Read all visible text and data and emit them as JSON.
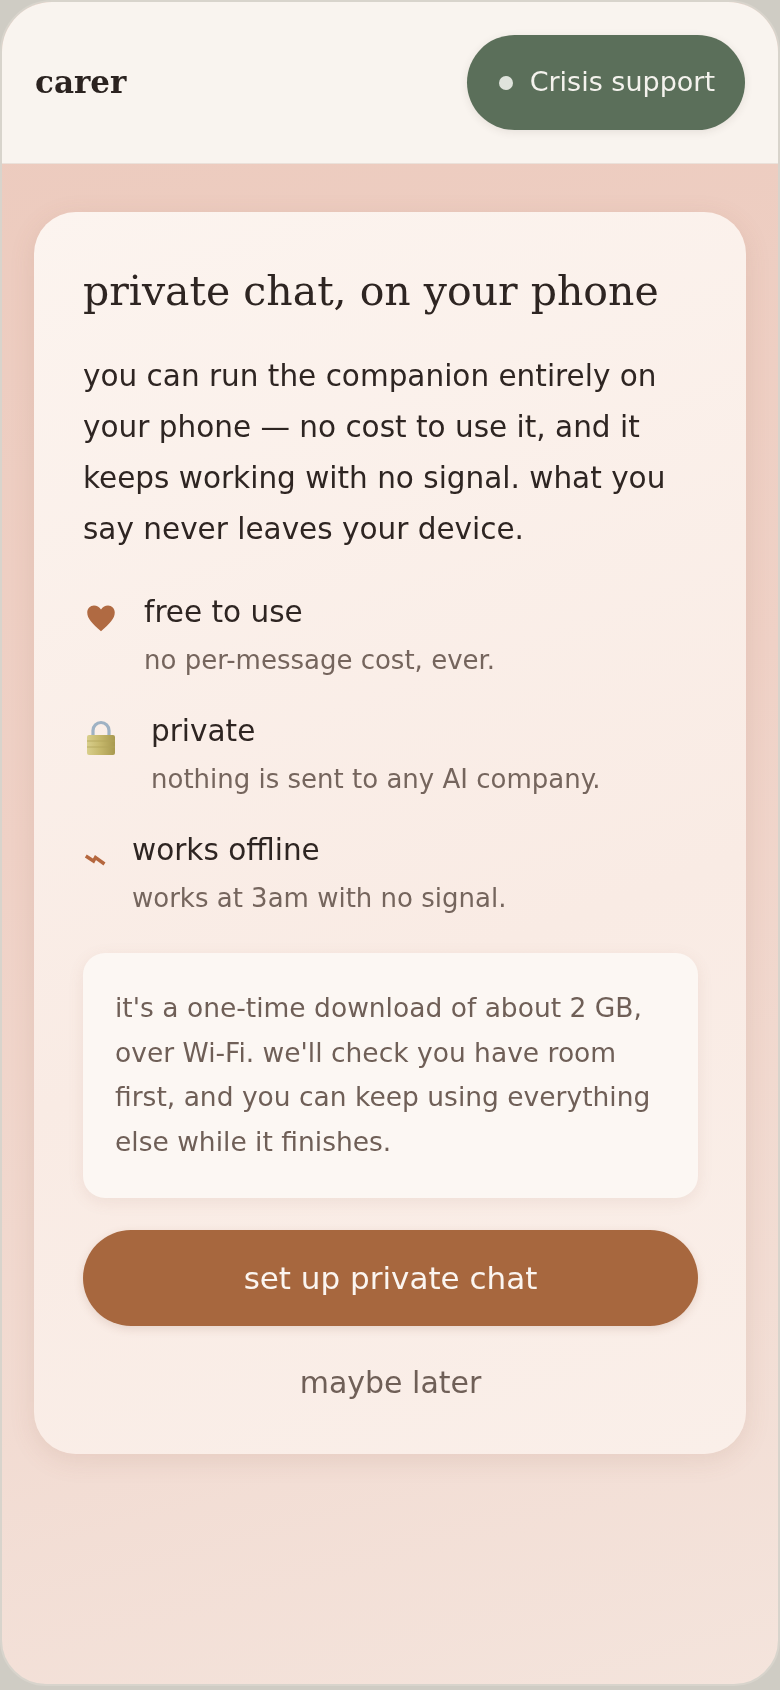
{
  "header": {
    "brand": "carer",
    "crisis_button": {
      "label": "Crisis support"
    }
  },
  "card": {
    "title": "private chat, on your phone",
    "intro": "you can run the companion entirely on your phone — no cost to use it, and it keeps working with no signal. what you say never leaves your device.",
    "features": [
      {
        "kind": "heart",
        "title": "free to use",
        "description": "no per-message cost, ever."
      },
      {
        "kind": "lock",
        "title": "private",
        "description": "nothing is sent to any AI company."
      },
      {
        "kind": "bolt",
        "title": "works offline",
        "description": "works at 3am with no signal."
      }
    ],
    "note": "it's a one-time download of about 2 GB, over Wi-Fi. we'll check you have room first, and you can keep using everything else while it finishes.",
    "primary_button": "set up private chat",
    "secondary_button": "maybe later"
  }
}
